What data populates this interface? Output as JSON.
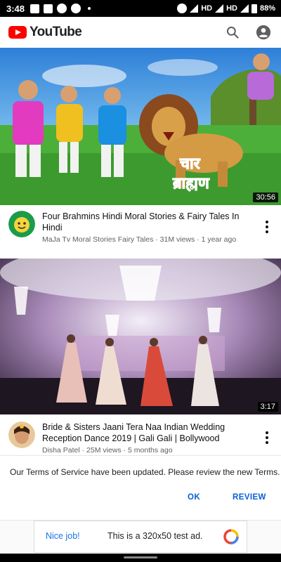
{
  "status_bar": {
    "time": "3:48",
    "network": "HD",
    "network2": "HD",
    "battery": "88%"
  },
  "app_bar": {
    "logo_text": "YouTube",
    "search_icon": "search-icon",
    "account_icon": "account-circle-icon"
  },
  "videos": [
    {
      "thumb_text": "चार ब्राह्मण",
      "duration": "30:56",
      "title": "Four Brahmins Hindi Moral Stories & Fairy Tales In Hindi",
      "subtitle": "MaJa Tv Moral Stories Fairy Tales · 31M views · 1 year ago"
    },
    {
      "duration": "3:17",
      "title": "Bride & Sisters Jaani Tera Naa Indian Wedding Reception Dance 2019 | Gali Gali | Bollywood",
      "subtitle": "Disha Patel · 25M views · 5 months ago"
    }
  ],
  "terms": {
    "message": "Our Terms of Service have been updated. Please review the new Terms.",
    "ok": "OK",
    "review": "REVIEW"
  },
  "ad": {
    "nice": "Nice job!",
    "text": "This is a 320x50 test ad."
  },
  "colors": {
    "brand_red": "#ff0000",
    "link_blue": "#065fd4"
  }
}
